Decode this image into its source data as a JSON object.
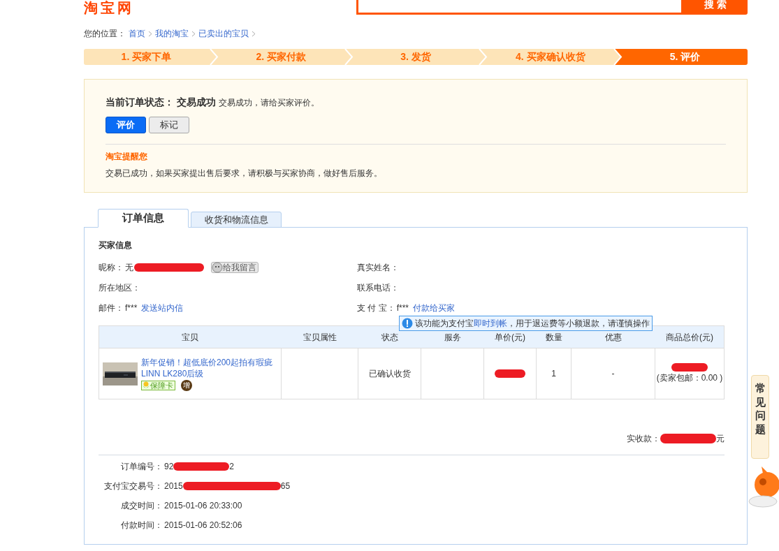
{
  "logo": "淘宝网",
  "search": {
    "button": "搜 索"
  },
  "breadcrumb": {
    "label": "您的位置：",
    "links": [
      "首页",
      "我的淘宝",
      "已卖出的宝贝"
    ]
  },
  "steps": [
    {
      "label": "1. 买家下单",
      "selected": false
    },
    {
      "label": "2. 买家付款",
      "selected": false
    },
    {
      "label": "3. 发货",
      "selected": false
    },
    {
      "label": "4. 买家确认收货",
      "selected": false
    },
    {
      "label": "5. 评价",
      "selected": true
    }
  ],
  "status": {
    "label": "当前订单状态：",
    "value": "交易成功",
    "note": "交易成功，请给买家评价。",
    "buttons": [
      {
        "label": "评价",
        "kind": "primary"
      },
      {
        "label": "标记",
        "kind": "secondary"
      }
    ],
    "reminder_title": "淘宝提醒您",
    "reminder_text": "交易已成功，如果买家提出售后要求，请积极与买家协商，做好售后服务。"
  },
  "tabs": [
    {
      "label": "订单信息",
      "selected": true
    },
    {
      "label": "收货和物流信息",
      "selected": false
    }
  ],
  "buyer": {
    "title": "买家信息",
    "left": [
      {
        "label": "昵称：",
        "value": "无",
        "redacted": true,
        "action": "给我留言"
      },
      {
        "label": "所在地区："
      },
      {
        "label": "邮件：",
        "value": "f***",
        "link": "发送站内信"
      }
    ],
    "right": [
      {
        "label": "真实姓名："
      },
      {
        "label": "联系电话："
      },
      {
        "label": "支 付 宝：",
        "value": "f***",
        "link": "付款给买家"
      }
    ],
    "tooltip": {
      "before": "该功能为支付宝",
      "link": "即时到帐",
      "after": "，用于退运费等小额退款，请谨慎操作"
    }
  },
  "table": {
    "columns": [
      "宝贝",
      "宝贝属性",
      "状态",
      "服务",
      "单价(元)",
      "数量",
      "优惠",
      "商品总价(元)"
    ],
    "rows": [
      {
        "title": "新年促销！超低底价200起拍有瑕疵LINN LK280后级",
        "badge": "保障卡",
        "tag": "增",
        "status": "已确认收货",
        "price_redacted": true,
        "quantity": "1",
        "discount": "-",
        "total_redacted": true,
        "total_note": "(卖家包邮：0.00 )"
      }
    ]
  },
  "received": {
    "label": "实收款：",
    "redacted": true,
    "unit": "元"
  },
  "order_details": [
    {
      "label": "订单编号：",
      "parts": [
        "92",
        "2"
      ]
    },
    {
      "label": "支付宝交易号：",
      "parts": [
        "2015",
        "65"
      ]
    },
    {
      "label": "成交时间：",
      "parts": [
        "2015-01-06 20:33:00"
      ]
    },
    {
      "label": "付款时间：",
      "parts": [
        "2015-01-06 20:52:06"
      ]
    }
  ],
  "side_tab": "常见问题"
}
